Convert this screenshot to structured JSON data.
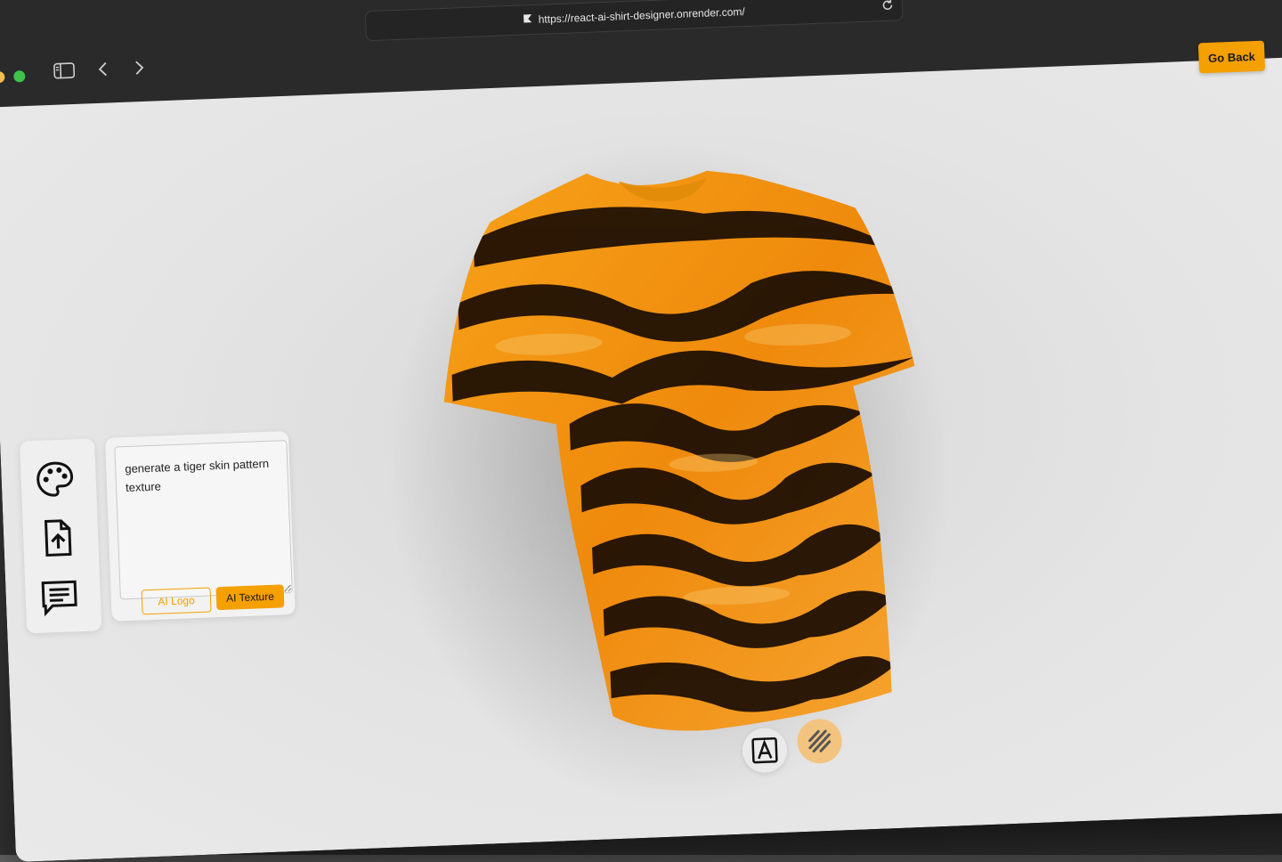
{
  "browser": {
    "url": "https://react-ai-shirt-designer.onrender.com/"
  },
  "header": {
    "go_back_label": "Go Back"
  },
  "ai_picker": {
    "prompt_value": "generate a tiger skin pattern texture",
    "ai_logo_label": "AI Logo",
    "ai_texture_label": "AI Texture"
  },
  "editor_tabs": [
    "colorpicker",
    "filepicker",
    "aipicker"
  ],
  "filter_tabs": [
    "logoShirt",
    "stylishShirt"
  ],
  "colors": {
    "accent": "#F4A000",
    "texture_tab_active": "#F2C47F",
    "background": "#E6E6E6"
  }
}
